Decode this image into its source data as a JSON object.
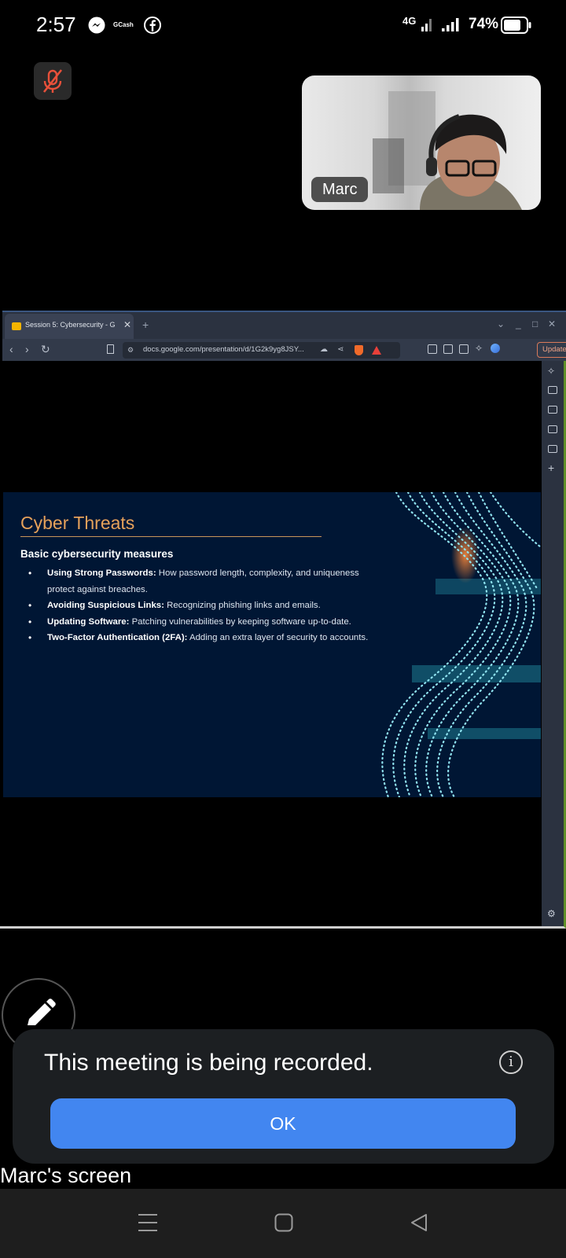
{
  "status_bar": {
    "time": "2:57",
    "notification_icons": [
      "messenger-icon",
      "gcash-icon",
      "facebook-icon"
    ],
    "gcash_label": "GCash",
    "network": "4G",
    "battery_percent": "74%"
  },
  "call": {
    "mic_state": "muted",
    "participant_name": "Marc",
    "screen_owner_label": "Marc's screen"
  },
  "browser": {
    "tab_title": "Session 5: Cybersecurity - G",
    "url": "docs.google.com/presentation/d/1G2k9yg8JSY...",
    "update_label": "Update"
  },
  "slide": {
    "title": "Cyber Threats",
    "subtitle": "Basic cybersecurity measures",
    "bullets": [
      {
        "term": "Using Strong Passwords:",
        "text": " How password length, complexity, and uniqueness protect against breaches."
      },
      {
        "term": "Avoiding Suspicious Links:",
        "text": " Recognizing phishing links and emails."
      },
      {
        "term": "Updating Software:",
        "text": " Patching vulnerabilities by keeping software up-to-date."
      },
      {
        "term": "Two-Factor Authentication (2FA):",
        "text": " Adding an extra layer of security to accounts."
      }
    ]
  },
  "recording_banner": {
    "message": "This meeting is being recorded.",
    "ok_label": "OK",
    "info_glyph": "i"
  },
  "colors": {
    "accent_blue": "#4286f0",
    "slide_background": "#001634",
    "slide_title": "#e6a15a",
    "mic_muted_red": "#e8503a"
  }
}
